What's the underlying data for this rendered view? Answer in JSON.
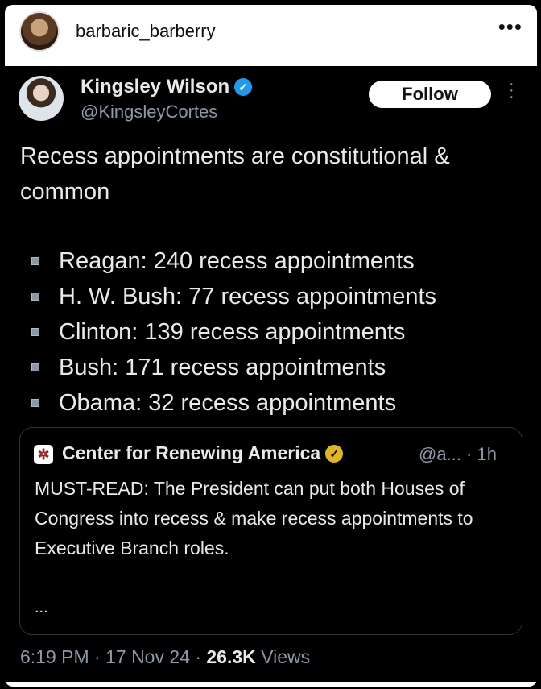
{
  "post": {
    "username": "barbaric_barberry",
    "more": "•••"
  },
  "tweet": {
    "author_name": "Kingsley Wilson",
    "author_handle": "@KingsleyCortes",
    "verified_glyph": "✓",
    "follow_label": "Follow",
    "text": "Recess appointments are constitutional & common",
    "list": [
      "Reagan: 240 recess appointments",
      "H. W. Bush: 77 recess appointments",
      "Clinton: 139 recess appointments",
      "Bush: 171 recess appointments",
      "Obama: 32 recess appointments"
    ],
    "quote": {
      "name": "Center for Renewing America",
      "handle": "@a... · 1h",
      "text": "MUST-READ: The President can put both Houses of Congress into recess & make recess appointments to Executive Branch roles.",
      "ellipsis": "..."
    },
    "time": "6:19 PM · 17 Nov 24 · ",
    "views_count": "26.3K",
    "views_label": " Views"
  },
  "colors": {
    "verified_blue": "#1d9bf0",
    "gold_badge": "#e2b719",
    "muted": "#8b98a5",
    "text": "#e7e9ea"
  },
  "icons": [
    "verified-badge-icon",
    "gold-verified-badge-icon",
    "more-options-icon",
    "kebab-menu-icon",
    "bullet-icon"
  ]
}
